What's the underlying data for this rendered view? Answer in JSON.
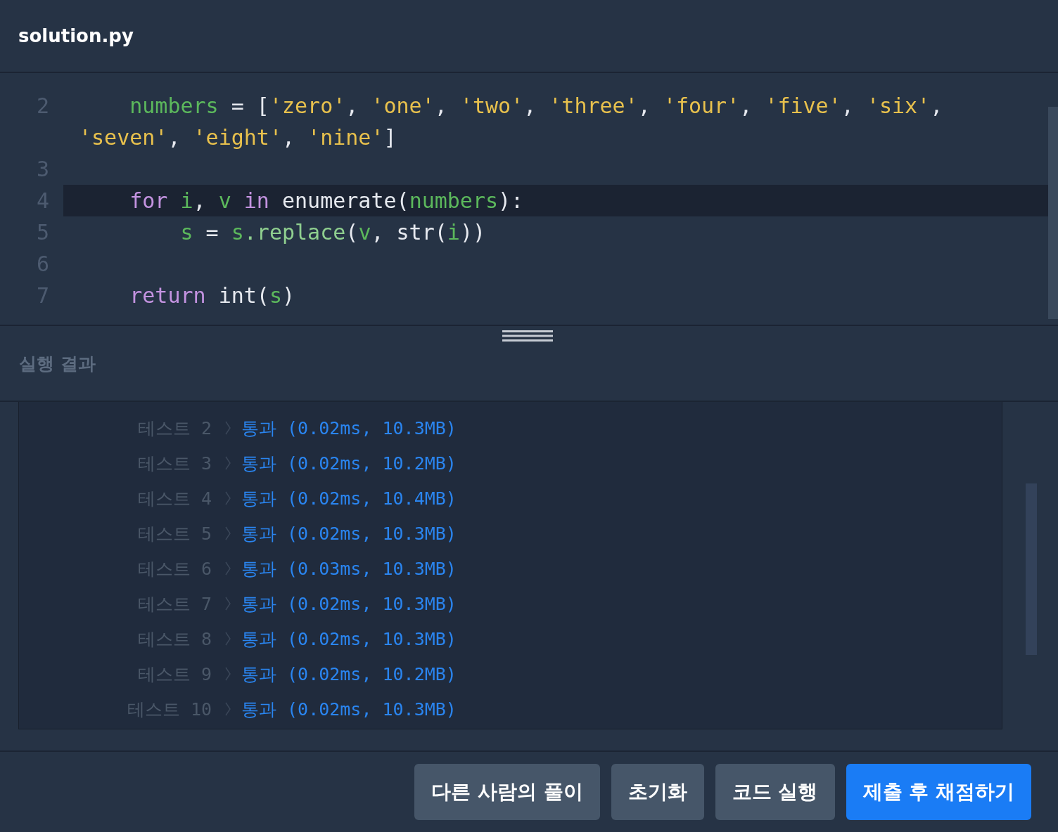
{
  "editor": {
    "filename": "solution.py",
    "lines": [
      {
        "number": "2",
        "active": false,
        "tokens": [
          {
            "text": "    numbers",
            "kind": "var"
          },
          {
            "text": " = [",
            "kind": "plain"
          },
          {
            "text": "'zero'",
            "kind": "str"
          },
          {
            "text": ", ",
            "kind": "plain"
          },
          {
            "text": "'one'",
            "kind": "str"
          },
          {
            "text": ", ",
            "kind": "plain"
          },
          {
            "text": "'two'",
            "kind": "str"
          },
          {
            "text": ", ",
            "kind": "plain"
          },
          {
            "text": "'three'",
            "kind": "str"
          },
          {
            "text": ", ",
            "kind": "plain"
          },
          {
            "text": "'four'",
            "kind": "str"
          },
          {
            "text": ", ",
            "kind": "plain"
          },
          {
            "text": "'five'",
            "kind": "str"
          },
          {
            "text": ", ",
            "kind": "plain"
          },
          {
            "text": "'six'",
            "kind": "str"
          },
          {
            "text": ",",
            "kind": "plain"
          }
        ]
      },
      {
        "active": false,
        "tokens": [
          {
            "text": "'seven'",
            "kind": "str"
          },
          {
            "text": ", ",
            "kind": "plain"
          },
          {
            "text": "'eight'",
            "kind": "str"
          },
          {
            "text": ", ",
            "kind": "plain"
          },
          {
            "text": "'nine'",
            "kind": "str"
          },
          {
            "text": "]",
            "kind": "plain"
          }
        ]
      },
      {
        "number": "3",
        "active": false
      },
      {
        "number": "4",
        "active": true,
        "tokens": [
          {
            "text": "    for",
            "kind": "kw"
          },
          {
            "text": " i",
            "kind": "var"
          },
          {
            "text": ", ",
            "kind": "plain"
          },
          {
            "text": "v",
            "kind": "var"
          },
          {
            "text": " in",
            "kind": "kw"
          },
          {
            "text": " enumerate(",
            "kind": "plain"
          },
          {
            "text": "numbers",
            "kind": "var"
          },
          {
            "text": "):",
            "kind": "plain"
          }
        ]
      },
      {
        "number": "5",
        "active": false,
        "tokens": [
          {
            "text": "        s",
            "kind": "var"
          },
          {
            "text": " = ",
            "kind": "plain"
          },
          {
            "text": "s",
            "kind": "var"
          },
          {
            "text": ".replace",
            "kind": "method"
          },
          {
            "text": "(",
            "kind": "plain"
          },
          {
            "text": "v",
            "kind": "var"
          },
          {
            "text": ", str(",
            "kind": "plain"
          },
          {
            "text": "i",
            "kind": "var"
          },
          {
            "text": "))",
            "kind": "plain"
          }
        ]
      },
      {
        "number": "6",
        "active": false
      },
      {
        "number": "7",
        "active": false,
        "tokens": [
          {
            "text": "    return",
            "kind": "kw"
          },
          {
            "text": " int(",
            "kind": "plain"
          },
          {
            "text": "s",
            "kind": "var"
          },
          {
            "text": ")",
            "kind": "plain"
          }
        ]
      }
    ]
  },
  "results": {
    "title": "실행 결과",
    "rows": [
      {
        "label": "테스트 2",
        "result": "통과 (0.02ms, 10.3MB)"
      },
      {
        "label": "테스트 3",
        "result": "통과 (0.02ms, 10.2MB)"
      },
      {
        "label": "테스트 4",
        "result": "통과 (0.02ms, 10.4MB)"
      },
      {
        "label": "테스트 5",
        "result": "통과 (0.02ms, 10.3MB)"
      },
      {
        "label": "테스트 6",
        "result": "통과 (0.03ms, 10.3MB)"
      },
      {
        "label": "테스트 7",
        "result": "통과 (0.02ms, 10.3MB)"
      },
      {
        "label": "테스트 8",
        "result": "통과 (0.02ms, 10.3MB)"
      },
      {
        "label": "테스트 9",
        "result": "통과 (0.02ms, 10.2MB)"
      },
      {
        "label": "테스트 10",
        "result": "통과 (0.02ms, 10.3MB)"
      }
    ]
  },
  "buttons": [
    {
      "label": "다른 사람의 풀이",
      "kind": "secondary"
    },
    {
      "label": "초기화",
      "kind": "secondary"
    },
    {
      "label": "코드 실행",
      "kind": "secondary"
    },
    {
      "label": "제출 후 채점하기",
      "kind": "primary"
    }
  ]
}
